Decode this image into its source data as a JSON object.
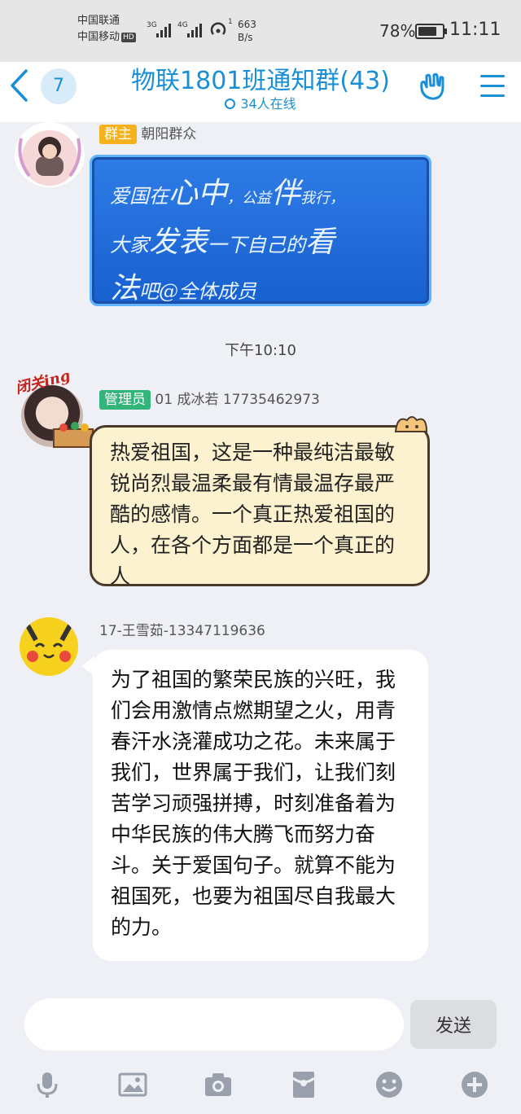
{
  "status_bar": {
    "carrier1": "中国联通",
    "carrier2": "中国移动",
    "hd": "HD",
    "net1": "3G",
    "net2": "4G",
    "speed_value": "663",
    "speed_unit": "B/s",
    "battery": "78%",
    "time": "11:11"
  },
  "header": {
    "unread_count": "7",
    "title": "物联1801班通知群(43)",
    "online": "34人在线"
  },
  "messages": [
    {
      "role": "群主",
      "role_color": "#f5b21c",
      "sender": "朝阳群众",
      "lines": [
        {
          "parts": [
            "爱国在",
            "心中",
            "，公益",
            "伴",
            "我行，"
          ]
        },
        {
          "parts": [
            "大家",
            "发表",
            "一下自己的",
            "看"
          ]
        },
        {
          "parts": [
            "法",
            "吧@全体成员"
          ]
        }
      ]
    },
    {
      "time": "下午10:10"
    },
    {
      "role": "管理员",
      "role_color": "#33b47b",
      "sender": "01 成冰若 17735462973",
      "avatar_label": "闭关ing",
      "text": "热爱祖国，这是一种最纯洁最敏锐尚烈最温柔最有情最温存最严酷的感情。一个真正热爱祖国的人，在各个方面都是一个真正的人"
    },
    {
      "sender": "17-王雪茹-13347119636",
      "text": "为了祖国的繁荣民族的兴旺，我们会用激情点燃期望之火，用青春汗水浇灌成功之花。未来属于我们，世界属于我们，让我们刻苦学习顽强拼搏，时刻准备着为中华民族的伟大腾飞而努力奋斗。关于爱国句子。就算不能为祖国死，也要为祖国尽自我最大的力。"
    }
  ],
  "input": {
    "placeholder": "",
    "send_label": "发送"
  },
  "toolbar": [
    "mic-icon",
    "image-icon",
    "camera-icon",
    "red-packet-icon",
    "emoji-icon",
    "plus-icon"
  ],
  "colors": {
    "accent": "#1a8fd6",
    "bg": "#eef0f5"
  }
}
